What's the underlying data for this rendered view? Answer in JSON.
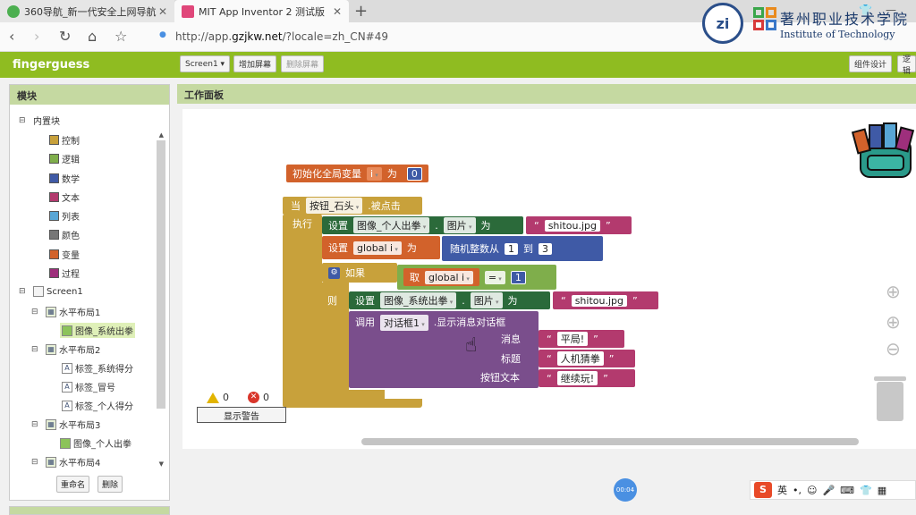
{
  "browser": {
    "tabs": [
      {
        "title": "360导航_新一代安全上网导航"
      },
      {
        "title": "MIT App Inventor 2 测试版"
      }
    ],
    "url_prefix": "http://app.",
    "url_domain": "gzjkw.net",
    "url_suffix": "/?locale=zh_CN#49"
  },
  "logo": {
    "seal_text": "zi",
    "cn_title": "著州职业技术学院",
    "en_subtitle": "Institute of Technology"
  },
  "app": {
    "project_name": "fingerguess",
    "screen_select": "Screen1",
    "add_screen": "增加屏幕",
    "remove_screen": "删除屏幕",
    "designer_button": "组件设计",
    "blocks_button": "逻辑"
  },
  "palette": {
    "title": "模块",
    "builtin": "内置块",
    "categories": [
      {
        "label": "控制",
        "color": "#c8a13b"
      },
      {
        "label": "逻辑",
        "color": "#7fae4b"
      },
      {
        "label": "数学",
        "color": "#3f5aa6"
      },
      {
        "label": "文本",
        "color": "#b33a6e"
      },
      {
        "label": "列表",
        "color": "#58a6d6"
      },
      {
        "label": "颜色",
        "color": "#777777"
      },
      {
        "label": "变量",
        "color": "#d2622b"
      },
      {
        "label": "过程",
        "color": "#9e2f7c"
      }
    ],
    "components": [
      {
        "label": "Screen1"
      },
      {
        "label": "水平布局1"
      },
      {
        "label": "图像_系统出拳"
      },
      {
        "label": "水平布局2"
      },
      {
        "label": "标签_系统得分"
      },
      {
        "label": "标签_冒号"
      },
      {
        "label": "标签_个人得分"
      },
      {
        "label": "水平布局3"
      },
      {
        "label": "图像_个人出拳"
      },
      {
        "label": "水平布局4"
      }
    ],
    "rename": "重命名",
    "delete": "删除"
  },
  "workspace": {
    "title": "工作面板",
    "init_global": {
      "label": "初始化全局变量",
      "var": "i",
      "as": "为",
      "value": "0"
    },
    "event": {
      "when": "当",
      "component": "按钮_石头",
      "event": ".被点击",
      "do": "执行"
    },
    "set1": {
      "set": "设置",
      "component": "图像_个人出拳",
      "prop": "图片",
      "to": "为",
      "value": "shitou.jpg"
    },
    "set2": {
      "set": "设置",
      "var": "global i",
      "to": "为",
      "rand": "随机整数从",
      "from": "1",
      "between": "到",
      "upto": "3"
    },
    "if": {
      "if": "如果",
      "get": "取",
      "var": "global i",
      "op": "=",
      "value": "1",
      "then": "则"
    },
    "set3": {
      "set": "设置",
      "component": "图像_系统出拳",
      "prop": "图片",
      "to": "为",
      "value": "shitou.jpg"
    },
    "call": {
      "call": "调用",
      "component": "对话框1",
      "method": ".显示消息对话框",
      "msg_label": "消息",
      "msg": "平局!",
      "title_label": "标题",
      "title": "人机猜拳",
      "btn_label": "按钮文本",
      "btn": "继续玩!"
    },
    "warnings": "0",
    "errors": "0",
    "show_warnings": "显示警告"
  },
  "status": {
    "timer": "00:04",
    "ime_lang": "英"
  }
}
